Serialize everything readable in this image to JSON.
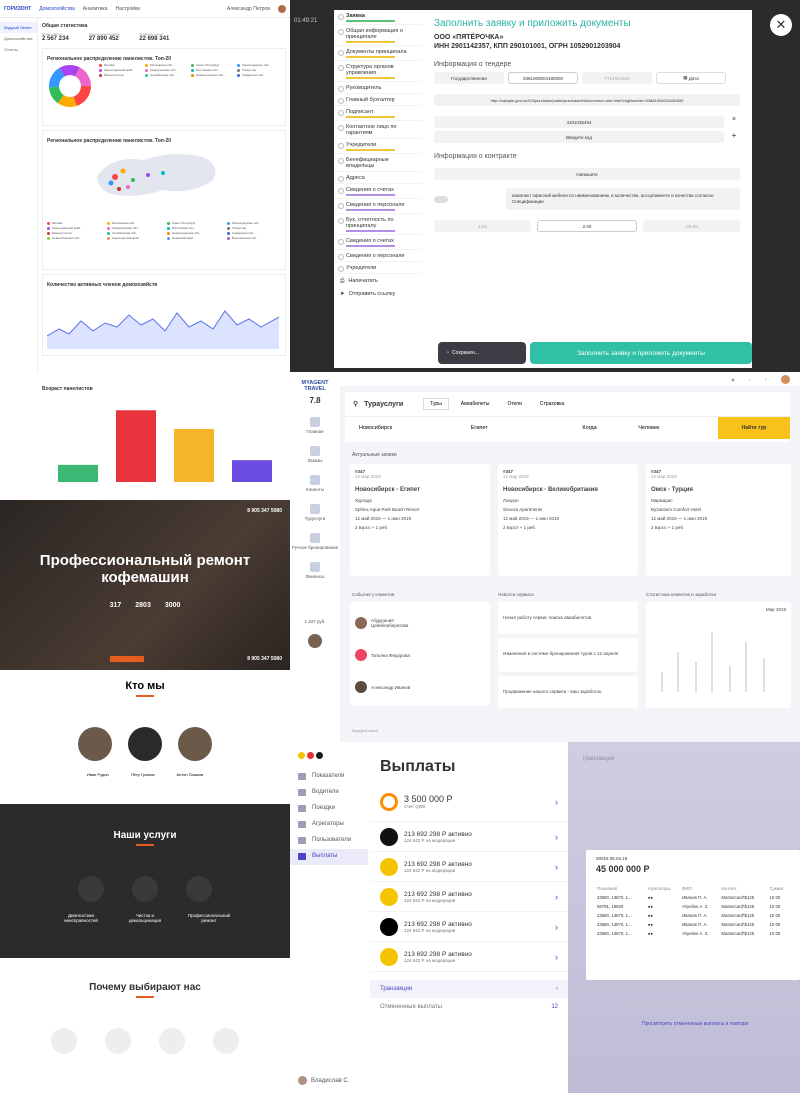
{
  "panelA": {
    "logo": "ГОРИЗОНТ",
    "nav": [
      "Домохозяйства",
      "Аналитика",
      "Настройки"
    ],
    "user": "Александр Петров",
    "side": [
      "Мудрый Ленин",
      "Домохозяйства",
      "Отчеты"
    ],
    "title": "Общая статистика",
    "stats": [
      {
        "label": "Домохозяйств",
        "value": "2 567 234"
      },
      {
        "label": "Членов домохозяйств",
        "value": "27 890 452"
      },
      {
        "label": "Активных членов",
        "value": "22 698 341"
      }
    ],
    "region_title": "Региональное распределение панелистов. Топ-20",
    "region_title2": "Региональное распределение панелистов. Топ-20",
    "active_title": "Количество активных членов домохозяйств",
    "age_title": "Возраст панелистов",
    "legend": [
      "Москва",
      "Московская обл.",
      "Санкт-Петербург",
      "Ленинградская обл.",
      "Краснодарский край",
      "Свердловская обл.",
      "Ростовская обл.",
      "Татарстан",
      "Башкортостан",
      "Челябинская обл.",
      "Нижегородская обл.",
      "Самарская обл.",
      "Новосибирская обл.",
      "Красноярский край",
      "Пермский край",
      "Воронежская обл."
    ],
    "age_bars": [
      0.22,
      0.92,
      0.68,
      0.28
    ]
  },
  "panelB": {
    "time": "01:49:21",
    "title": "Заполнить заявку и приложить документы",
    "org1": "ООО «ПЯТЁРОЧКА»",
    "org2": "ИНН 2901142357, КПП 290101001, ОГРН 1052901203904",
    "nav": [
      "Заявка",
      "Общая информация о принципале",
      "Документы принципала",
      "Структура органов управления",
      "Руководитель",
      "Главный бухгалтер",
      "Подписант",
      "Контактное лицо по гарантиям",
      "Учредители",
      "Бенефициарные владельцы",
      "Адреса",
      "Сведения о счетах",
      "Сведения о персонале",
      "Бух. отчетность по принципалу",
      "Сведения о счетах",
      "Сведения о персонале",
      "Учредители"
    ],
    "tender_h": "Информация о тендере",
    "fz": "Государственная",
    "reg_num": "0381000004180000",
    "lot": "7714081360",
    "date": "Дата",
    "link": "http://zakupki.gov.ru/223/purchase/public/purchase/info/common-info.html?regNumber=03881000004180000",
    "ikz": "4101035494",
    "enter_code": "Введите код",
    "contract_h": "Информация о контракте",
    "write": "Напишите",
    "subject": "комплект офисной мебели по наименованиям, в количестве, ассортименте и качества согласно Спецификации",
    "v1": "1.04",
    "v2": "2.00",
    "v3": "-55.08",
    "saved": "Сохранен...",
    "submit": "Заполнить заявку и приложить документы",
    "print": "Напечатать",
    "send": "Отправить ссылку"
  },
  "panelC": {
    "brand": "MYAGENT TRAVEL",
    "rating": "7.8",
    "nav": [
      "Главная",
      "Заказы",
      "Клиенты",
      "Туруслуги",
      "Ручное бронирование",
      "Финансы"
    ],
    "balance": "1 347 руб.",
    "title": "Турауслуги",
    "tabs": [
      "Туры",
      "Авиабилеты",
      "Отели",
      "Страховка"
    ],
    "from": "Новосибирск",
    "to": "Египет",
    "when": "Когда",
    "who": "Человек",
    "find": "Найти тур",
    "actual": "Актуальные заявки",
    "orders": [
      {
        "num": "#347",
        "date": "12 мар 2019",
        "route": "Новосибирск - Египет",
        "city": "Хургада",
        "hotel": "Sphinx Aqua Park Beach Resort",
        "dates": "12 май 2019 — 1 июн 2019",
        "pax": "2 взрсл + 1 реб"
      },
      {
        "num": "#347",
        "date": "12 мар 2019",
        "route": "Новосибирск - Великобритания",
        "city": "Лондон",
        "hotel": "Snooze Apartments",
        "dates": "12 май 2019 — 1 июн 2019",
        "pax": "2 взрсл + 1 реб"
      },
      {
        "num": "#347",
        "date": "12 мар 2019",
        "route": "Омск - Турция",
        "city": "Мармарис",
        "hotel": "Byzantium Comfort Hotel",
        "dates": "12 май 2019 — 1 июн 2019",
        "pax": "2 взрсл + 1 реб"
      }
    ],
    "events_h": "События у клиентов",
    "clients": [
      "Абдурания Цейхбербератова",
      "Татьяна Федорова",
      "Александр Иванов"
    ],
    "news_h": "Новости сервиса",
    "news": [
      "Начал работу сервис поиска авиабилетов.",
      "Изменения в системе бронирования туров с 12 апреля",
      "Продвижение нашего сервиса - ваш заработок."
    ],
    "stats_h": "Статистика клиентов и заработка",
    "month": "Мар 2019",
    "footer": "Myagent.travel"
  },
  "panelD": {
    "phone": "8 905 347 5080",
    "hero": "Профессиональный ремонт кофемашин",
    "stats": [
      "317",
      "2803",
      "3000"
    ],
    "who": "Кто мы",
    "team": [
      "Иван Рудин",
      "Пётр Громов",
      "Антон Пашков"
    ],
    "services": "Наши услуги",
    "serv_items": [
      "Диагностика неисправностей",
      "Чистка и декальцинация",
      "Профессиональный ремонт"
    ]
  },
  "panelE": {
    "title": "Почему выбирают нас"
  },
  "panelF": {
    "side": [
      "Показатели",
      "Водители",
      "Поездки",
      "Агрегаторы",
      "Пользователи",
      "Выплаты"
    ],
    "user": "Владислав С.",
    "title": "Выплаты",
    "qiwi_amount": "3 500 000 Р",
    "qiwi_label": "Счет QIWI",
    "rows": [
      {
        "a": "213 692 298 Р активно",
        "b": "124 842 Р на модерации",
        "color": "#111111"
      },
      {
        "a": "213 692 298 Р активно",
        "b": "124 842 Р на модерации",
        "color": "#f5c400"
      },
      {
        "a": "213 692 298 Р активно",
        "b": "124 842 Р на модерации",
        "color": "#f5c400"
      },
      {
        "a": "213 692 298 Р активно",
        "b": "124 842 Р на модерации",
        "color": "#000000"
      },
      {
        "a": "213 692 298 Р активно",
        "b": "124 842 Р на модерации",
        "color": "#f5c400"
      }
    ],
    "transactions": "Транзакции",
    "cancelled": "Отмененные выплаты",
    "cancelled_count": "12"
  },
  "panelG": {
    "header": "Транзакции",
    "id": "00016 05.04.19",
    "amount": "45 000 000 Р",
    "link": "Просмотреть отмененные выплаты и повтори",
    "cols": [
      "Позывной",
      "Агрегаторы",
      "ФИО",
      "На счет",
      "Сумма"
    ],
    "rows": [
      [
        "23580, 13870, 1...",
        "",
        "Иванов П. А.",
        "Mastercard*$125",
        "10 00"
      ],
      [
        "58791, 19820",
        "",
        "Улунбек А. З.",
        "Mastercard*$125",
        "10 00"
      ],
      [
        "23580, 13870, 1...",
        "",
        "Иванов П. А.",
        "Mastercard*$125",
        "10 00"
      ],
      [
        "23580, 13870, 1...",
        "",
        "Иванов П. А.",
        "Mastercard*$125",
        "10 00"
      ],
      [
        "23580, 13870, 1...",
        "",
        "Улунбек А. З.",
        "Mastercard*$125",
        "10 00"
      ]
    ]
  }
}
